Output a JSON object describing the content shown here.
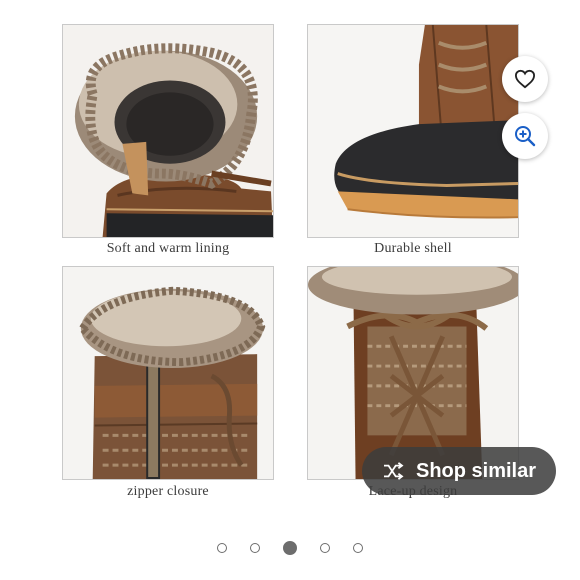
{
  "gallery": {
    "tiles": [
      {
        "caption": "Soft and warm lining"
      },
      {
        "caption": "Durable shell"
      },
      {
        "caption": "zipper closure"
      },
      {
        "caption": "Lace-up design"
      }
    ]
  },
  "actions": {
    "favorite_icon": "heart-icon",
    "zoom_icon": "zoom-in-icon",
    "shop_similar_label": "Shop similar",
    "shop_similar_icon": "shuffle-icon"
  },
  "pagination": {
    "count": 5,
    "active_index": 2
  },
  "colors": {
    "accent_blue": "#1a5fc7",
    "pill_bg": "#3c3c3c",
    "dot": "#6d6d6d"
  }
}
